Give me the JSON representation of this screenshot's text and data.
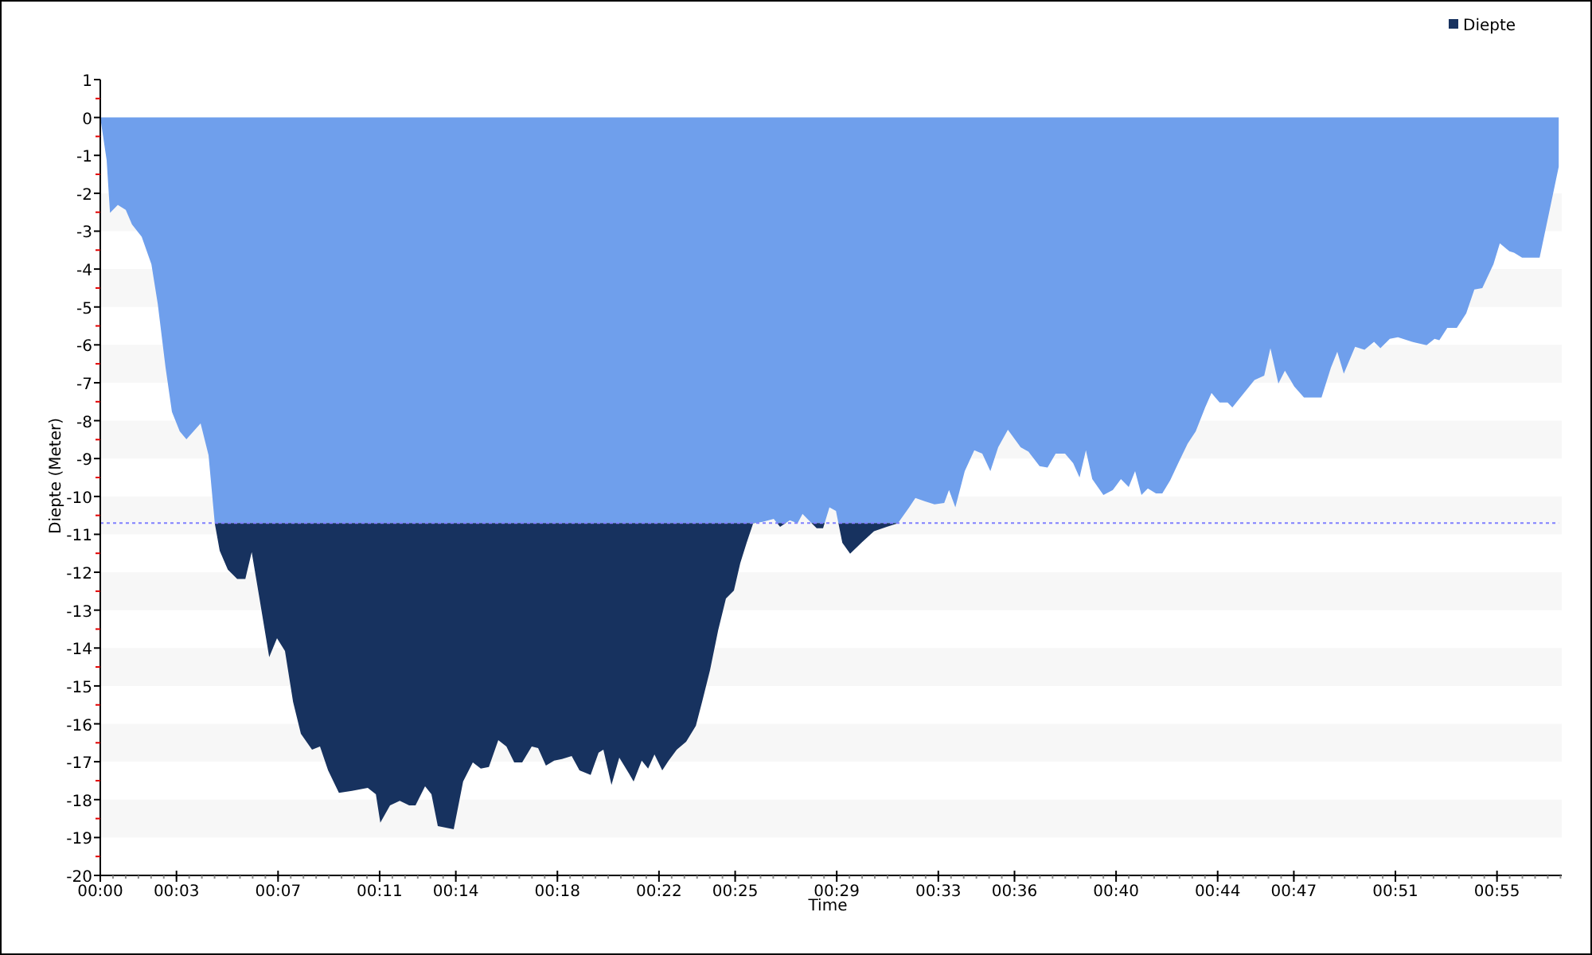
{
  "chart": {
    "chart_data": {
      "type": "area",
      "xlabel": "Time",
      "ylabel": "Diepte (Meter)",
      "xlim": [
        0,
        57.55
      ],
      "ylim": [
        -20,
        1
      ],
      "xticks": [
        {
          "value": 0,
          "label": "00:00"
        },
        {
          "value": 3,
          "label": "00:03"
        },
        {
          "value": 7,
          "label": "00:07"
        },
        {
          "value": 11,
          "label": "00:11"
        },
        {
          "value": 14,
          "label": "00:14"
        },
        {
          "value": 18,
          "label": "00:18"
        },
        {
          "value": 22,
          "label": "00:22"
        },
        {
          "value": 25,
          "label": "00:25"
        },
        {
          "value": 29,
          "label": "00:29"
        },
        {
          "value": 33,
          "label": "00:33"
        },
        {
          "value": 36,
          "label": "00:36"
        },
        {
          "value": 40,
          "label": "00:40"
        },
        {
          "value": 44,
          "label": "00:44"
        },
        {
          "value": 47,
          "label": "00:47"
        },
        {
          "value": 51,
          "label": "00:51"
        },
        {
          "value": 55,
          "label": "00:55"
        }
      ],
      "yticks": [
        1,
        0,
        -1,
        -2,
        -3,
        -4,
        -5,
        -6,
        -7,
        -8,
        -9,
        -10,
        -11,
        -12,
        -13,
        -14,
        -15,
        -16,
        -17,
        -18,
        -19,
        -20
      ],
      "x": [
        0,
        0.25,
        0.38,
        0.69,
        1.0,
        1.25,
        1.63,
        2.01,
        2.26,
        2.57,
        2.82,
        3.13,
        3.39,
        3.95,
        4.26,
        4.51,
        4.7,
        5.02,
        5.39,
        5.71,
        5.96,
        6.27,
        6.65,
        6.96,
        7.27,
        7.59,
        7.9,
        8.34,
        8.65,
        8.97,
        9.4,
        9.91,
        10.53,
        10.85,
        11.03,
        11.41,
        11.79,
        12.16,
        12.41,
        12.79,
        13.04,
        13.29,
        13.92,
        14.29,
        14.67,
        14.98,
        15.3,
        15.67,
        15.99,
        16.3,
        16.61,
        16.99,
        17.24,
        17.55,
        17.87,
        18.18,
        18.56,
        18.87,
        19.31,
        19.62,
        19.81,
        20.13,
        20.44,
        20.82,
        21.0,
        21.32,
        21.57,
        21.82,
        22.13,
        22.38,
        22.7,
        23.07,
        23.45,
        23.7,
        24.01,
        24.33,
        24.64,
        24.95,
        25.2,
        25.45,
        25.71,
        26.08,
        26.52,
        26.77,
        27.15,
        27.46,
        27.65,
        27.96,
        28.21,
        28.46,
        28.71,
        28.97,
        29.22,
        29.53,
        29.97,
        30.47,
        30.97,
        31.41,
        31.85,
        32.1,
        32.48,
        32.85,
        33.23,
        33.42,
        33.67,
        34.04,
        34.42,
        34.73,
        35.05,
        35.36,
        35.74,
        36.24,
        36.55,
        36.99,
        37.3,
        37.62,
        37.99,
        38.31,
        38.56,
        38.81,
        39.06,
        39.5,
        39.87,
        40.19,
        40.5,
        40.75,
        41.0,
        41.25,
        41.57,
        41.82,
        42.13,
        42.45,
        42.82,
        43.14,
        43.51,
        43.76,
        44.08,
        44.39,
        44.58,
        44.83,
        45.45,
        45.83,
        46.08,
        46.39,
        46.65,
        47.02,
        47.4,
        48.09,
        48.46,
        48.71,
        48.97,
        49.41,
        49.78,
        50.16,
        50.41,
        50.78,
        51.1,
        51.66,
        52.23,
        52.54,
        52.73,
        53.04,
        53.42,
        53.79,
        54.11,
        54.42,
        54.86,
        55.11,
        55.49,
        55.67,
        55.99,
        56.68,
        57.43
      ],
      "series": [
        {
          "name": "Diepte",
          "color": "#17325f",
          "values": [
            0,
            -1.13,
            -2.52,
            -2.31,
            -2.44,
            -2.82,
            -3.15,
            -3.87,
            -4.92,
            -6.6,
            -7.77,
            -8.28,
            -8.49,
            -8.07,
            -8.91,
            -10.71,
            -11.43,
            -11.93,
            -12.18,
            -12.18,
            -11.47,
            -12.69,
            -14.24,
            -13.74,
            -14.08,
            -15.42,
            -16.26,
            -16.68,
            -16.6,
            -17.23,
            -17.82,
            -17.77,
            -17.69,
            -17.86,
            -18.61,
            -18.15,
            -18.03,
            -18.15,
            -18.15,
            -17.65,
            -17.86,
            -18.7,
            -18.78,
            -17.52,
            -17.02,
            -17.18,
            -17.14,
            -16.43,
            -16.6,
            -17.02,
            -17.02,
            -16.6,
            -16.64,
            -17.1,
            -16.97,
            -16.93,
            -16.85,
            -17.23,
            -17.35,
            -16.76,
            -16.68,
            -17.61,
            -16.89,
            -17.31,
            -17.52,
            -16.97,
            -17.18,
            -16.81,
            -17.23,
            -16.97,
            -16.68,
            -16.47,
            -16.05,
            -15.42,
            -14.58,
            -13.53,
            -12.69,
            -12.48,
            -11.76,
            -11.22,
            -10.71,
            -10.67,
            -10.59,
            -10.8,
            -10.63,
            -10.71,
            -10.46,
            -10.67,
            -10.84,
            -10.84,
            -10.29,
            -10.38,
            -11.22,
            -11.51,
            -11.22,
            -10.92,
            -10.8,
            -10.71,
            -10.29,
            -10.04,
            -10.13,
            -10.21,
            -10.17,
            -9.83,
            -10.29,
            -9.33,
            -8.78,
            -8.87,
            -9.33,
            -8.7,
            -8.24,
            -8.7,
            -8.82,
            -9.2,
            -9.24,
            -8.87,
            -8.87,
            -9.12,
            -9.5,
            -8.78,
            -9.54,
            -9.96,
            -9.83,
            -9.54,
            -9.75,
            -9.33,
            -9.96,
            -9.79,
            -9.92,
            -9.92,
            -9.58,
            -9.12,
            -8.61,
            -8.28,
            -7.65,
            -7.27,
            -7.52,
            -7.52,
            -7.65,
            -7.44,
            -6.93,
            -6.81,
            -6.09,
            -7.02,
            -6.68,
            -7.1,
            -7.39,
            -7.39,
            -6.6,
            -6.18,
            -6.76,
            -6.05,
            -6.13,
            -5.92,
            -6.09,
            -5.84,
            -5.8,
            -5.92,
            -6.01,
            -5.84,
            -5.88,
            -5.55,
            -5.55,
            -5.17,
            -4.54,
            -4.5,
            -3.87,
            -3.32,
            -3.53,
            -3.57,
            -3.7,
            -3.7,
            -1.3
          ]
        }
      ],
      "ref_lines": [
        {
          "axis": "y",
          "value": -10.7,
          "color": "#8080ff"
        }
      ]
    }
  }
}
